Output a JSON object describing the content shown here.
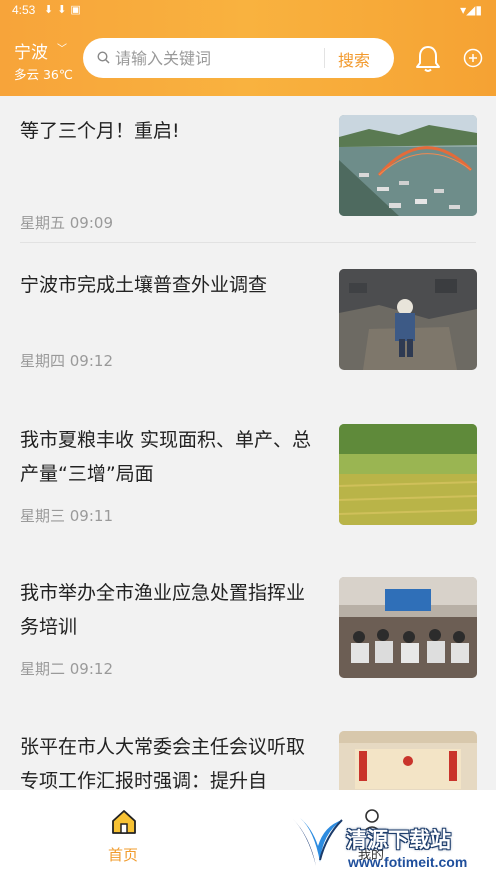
{
  "status_bar": {
    "time": "4:53"
  },
  "location": {
    "city": "宁波",
    "weather": "多云 36℃"
  },
  "search": {
    "placeholder": "请输入关键词",
    "button_label": "搜索"
  },
  "feed": [
    {
      "title": "等了三个月！重启!",
      "time": "星期五 09:09",
      "image": "bridge-boats-aerial"
    },
    {
      "title": "宁波市完成土壤普查外业调查",
      "time": "星期四 09:12",
      "image": "soil-survey-worker"
    },
    {
      "title": "我市夏粮丰收 实现面积、单产、总产量“三增”局面",
      "time": "星期三 09:11",
      "image": "rice-field"
    },
    {
      "title": "我市举办全市渔业应急处置指挥业务培训",
      "time": "星期二 09:12",
      "image": "training-meeting-hall"
    },
    {
      "title": "张平在市人大常委会主任会议听取专项工作汇报时强调：提升自",
      "time": "",
      "image": "conference-stage"
    }
  ],
  "tabbar": {
    "home_label": "首页",
    "mine_label": "我的"
  },
  "watermark": {
    "name": "清源下载站",
    "url": "www.fotimeit.com"
  },
  "colors": {
    "accent": "#f5a233",
    "accent_text": "#f19c2e",
    "background": "#f2f2f2"
  }
}
